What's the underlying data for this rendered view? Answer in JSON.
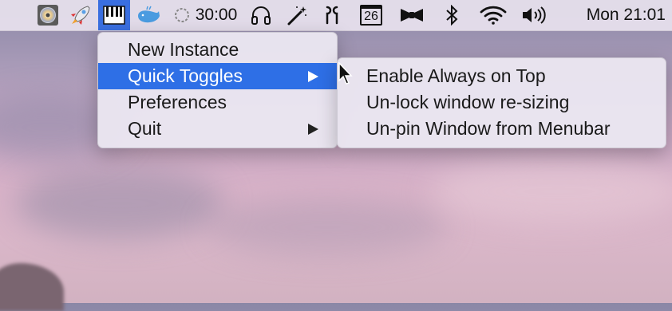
{
  "menubar": {
    "timer_text": "30:00",
    "calendar_day": "26",
    "clock": "Mon 21:01"
  },
  "app_menu": {
    "items": [
      {
        "label": "New Instance"
      },
      {
        "label": "Quick Toggles"
      },
      {
        "label": "Preferences"
      },
      {
        "label": "Quit"
      }
    ]
  },
  "submenu": {
    "items": [
      {
        "label": "Enable Always on Top"
      },
      {
        "label": "Un-lock window re-sizing"
      },
      {
        "label": "Un-pin Window from Menubar"
      }
    ]
  },
  "colors": {
    "selection": "#2e6fe6",
    "menubar_active": "#3a6fe0"
  },
  "icons": [
    "dvd-icon",
    "rocket-icon",
    "piano-icon",
    "whale-icon",
    "timer-icon",
    "headphones-icon",
    "magic-wand-icon",
    "airpods-icon",
    "calendar-icon",
    "bowtie-icon",
    "bluetooth-icon",
    "wifi-icon",
    "volume-icon",
    "mouse-cursor-icon"
  ]
}
